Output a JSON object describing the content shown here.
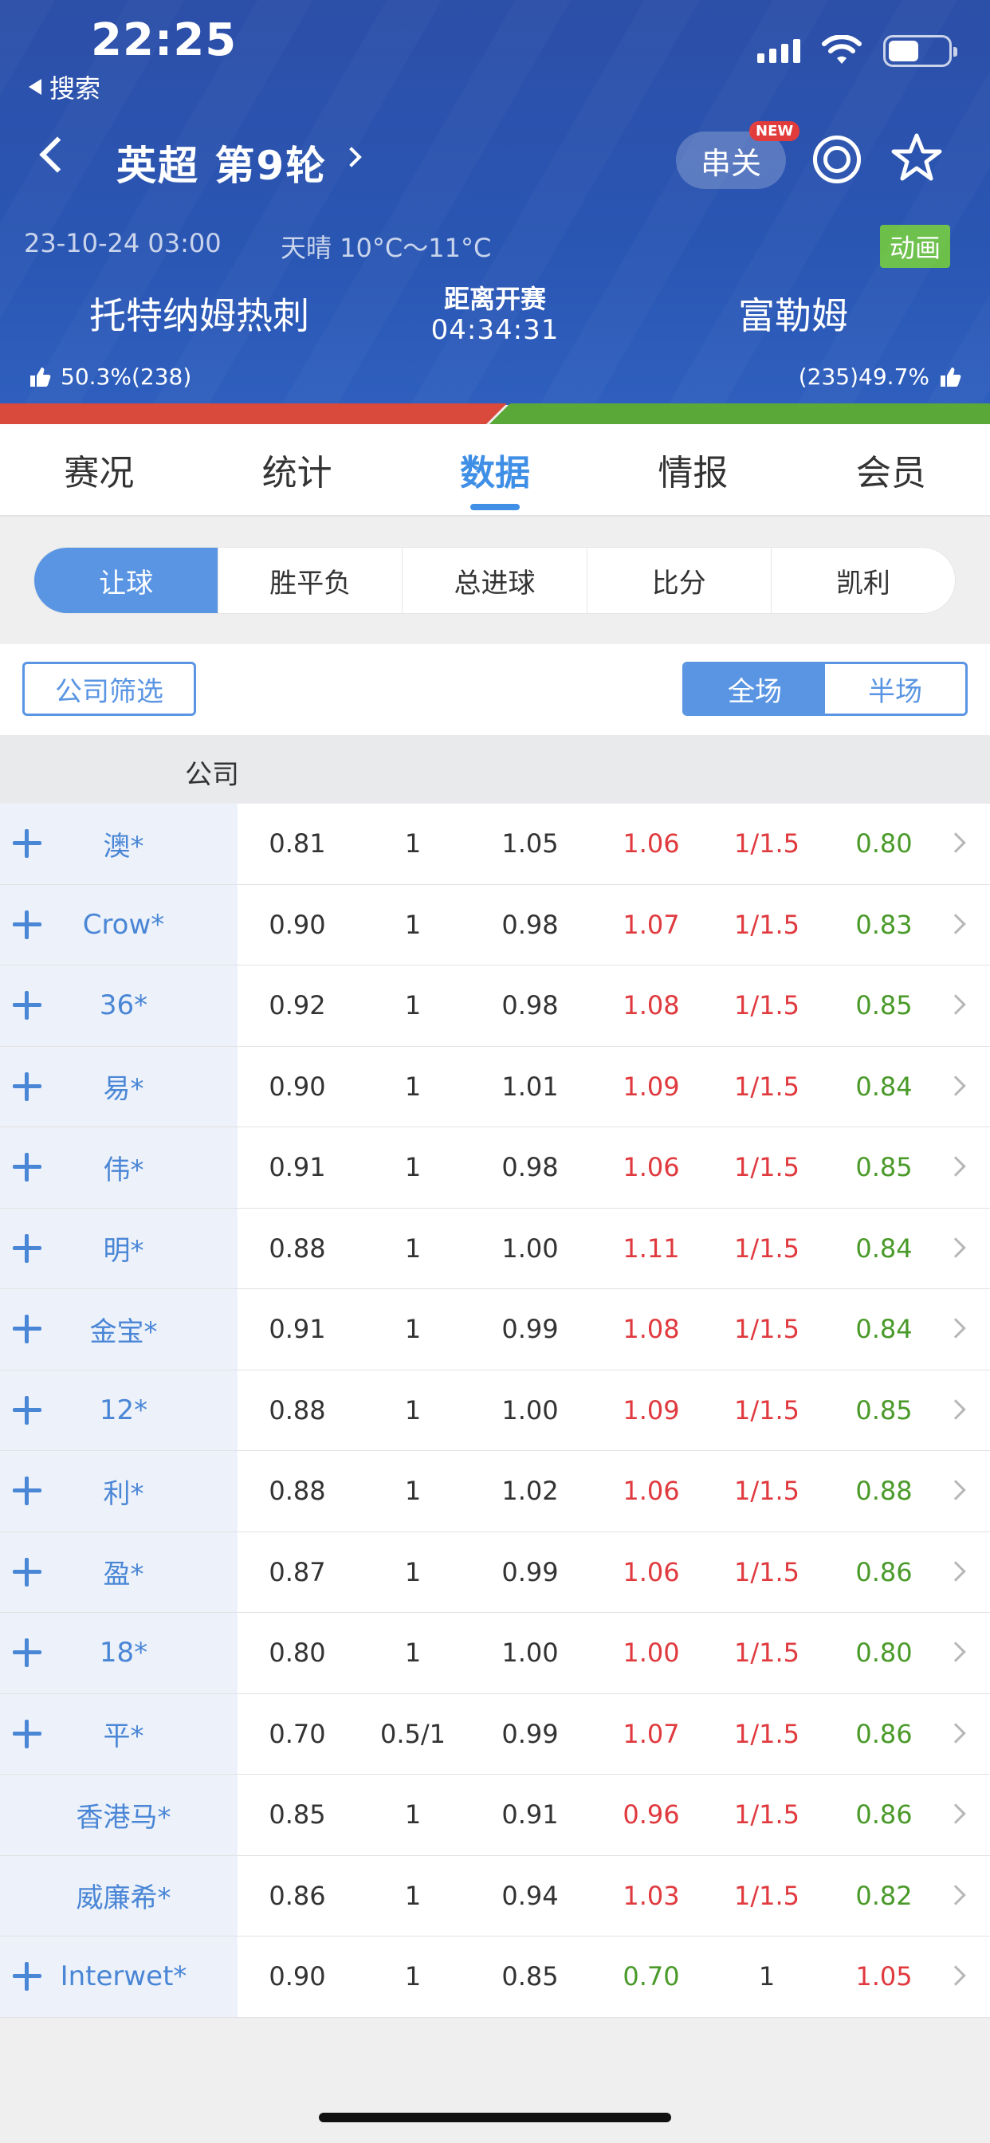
{
  "status_bar": {
    "time": "22:25",
    "back_label": "搜索"
  },
  "header": {
    "league": "英超 第9轮",
    "parlay_label": "串关",
    "new_badge": "NEW",
    "datetime": "23-10-24 03:00",
    "weather": "天晴 10°C～11°C",
    "animation_label": "动画",
    "home_team": "托特纳姆热刺",
    "away_team": "富勒姆",
    "countdown_label": "距离开赛",
    "countdown": "04:34:31",
    "home_vote": "50.3%(238)",
    "away_vote": "(235)49.7%"
  },
  "tabs": [
    "赛况",
    "统计",
    "数据",
    "情报",
    "会员"
  ],
  "active_tab": "数据",
  "subtabs": [
    "让球",
    "胜平负",
    "总进球",
    "比分",
    "凯利"
  ],
  "active_subtab": "让球",
  "filter": {
    "company_filter_label": "公司筛选",
    "full_label": "全场",
    "half_label": "半场"
  },
  "table": {
    "header": "公司",
    "rows": [
      {
        "name": "澳*",
        "plus": true,
        "v": [
          "0.81",
          "1",
          "1.05",
          "1.06",
          "1/1.5",
          "0.80"
        ],
        "c": [
          "dark",
          "dark",
          "dark",
          "red",
          "red",
          "green"
        ]
      },
      {
        "name": "Crow*",
        "plus": true,
        "v": [
          "0.90",
          "1",
          "0.98",
          "1.07",
          "1/1.5",
          "0.83"
        ],
        "c": [
          "dark",
          "dark",
          "dark",
          "red",
          "red",
          "green"
        ]
      },
      {
        "name": "36*",
        "plus": true,
        "v": [
          "0.92",
          "1",
          "0.98",
          "1.08",
          "1/1.5",
          "0.85"
        ],
        "c": [
          "dark",
          "dark",
          "dark",
          "red",
          "red",
          "green"
        ]
      },
      {
        "name": "易*",
        "plus": true,
        "v": [
          "0.90",
          "1",
          "1.01",
          "1.09",
          "1/1.5",
          "0.84"
        ],
        "c": [
          "dark",
          "dark",
          "dark",
          "red",
          "red",
          "green"
        ]
      },
      {
        "name": "伟*",
        "plus": true,
        "v": [
          "0.91",
          "1",
          "0.98",
          "1.06",
          "1/1.5",
          "0.85"
        ],
        "c": [
          "dark",
          "dark",
          "dark",
          "red",
          "red",
          "green"
        ]
      },
      {
        "name": "明*",
        "plus": true,
        "v": [
          "0.88",
          "1",
          "1.00",
          "1.11",
          "1/1.5",
          "0.84"
        ],
        "c": [
          "dark",
          "dark",
          "dark",
          "red",
          "red",
          "green"
        ]
      },
      {
        "name": "金宝*",
        "plus": true,
        "v": [
          "0.91",
          "1",
          "0.99",
          "1.08",
          "1/1.5",
          "0.84"
        ],
        "c": [
          "dark",
          "dark",
          "dark",
          "red",
          "red",
          "green"
        ]
      },
      {
        "name": "12*",
        "plus": true,
        "v": [
          "0.88",
          "1",
          "1.00",
          "1.09",
          "1/1.5",
          "0.85"
        ],
        "c": [
          "dark",
          "dark",
          "dark",
          "red",
          "red",
          "green"
        ]
      },
      {
        "name": "利*",
        "plus": true,
        "v": [
          "0.88",
          "1",
          "1.02",
          "1.06",
          "1/1.5",
          "0.88"
        ],
        "c": [
          "dark",
          "dark",
          "dark",
          "red",
          "red",
          "green"
        ]
      },
      {
        "name": "盈*",
        "plus": true,
        "v": [
          "0.87",
          "1",
          "0.99",
          "1.06",
          "1/1.5",
          "0.86"
        ],
        "c": [
          "dark",
          "dark",
          "dark",
          "red",
          "red",
          "green"
        ]
      },
      {
        "name": "18*",
        "plus": true,
        "v": [
          "0.80",
          "1",
          "1.00",
          "1.00",
          "1/1.5",
          "0.80"
        ],
        "c": [
          "dark",
          "dark",
          "dark",
          "red",
          "red",
          "green"
        ]
      },
      {
        "name": "平*",
        "plus": true,
        "v": [
          "0.70",
          "0.5/1",
          "0.99",
          "1.07",
          "1/1.5",
          "0.86"
        ],
        "c": [
          "dark",
          "dark",
          "dark",
          "red",
          "red",
          "green"
        ]
      },
      {
        "name": "香港马*",
        "plus": false,
        "v": [
          "0.85",
          "1",
          "0.91",
          "0.96",
          "1/1.5",
          "0.86"
        ],
        "c": [
          "dark",
          "dark",
          "dark",
          "red",
          "red",
          "green"
        ]
      },
      {
        "name": "威廉希*",
        "plus": false,
        "v": [
          "0.86",
          "1",
          "0.94",
          "1.03",
          "1/1.5",
          "0.82"
        ],
        "c": [
          "dark",
          "dark",
          "dark",
          "red",
          "red",
          "green"
        ]
      },
      {
        "name": "Interwet*",
        "plus": true,
        "v": [
          "0.90",
          "1",
          "0.85",
          "0.70",
          "1",
          "1.05"
        ],
        "c": [
          "dark",
          "dark",
          "dark",
          "green",
          "dark",
          "red"
        ]
      }
    ]
  },
  "colors": {
    "header_blue": "#2a56b3",
    "accent_blue": "#5a95e3",
    "red": "#e0393e",
    "green": "#4a9a2a",
    "badge_green": "#6cc04a"
  }
}
